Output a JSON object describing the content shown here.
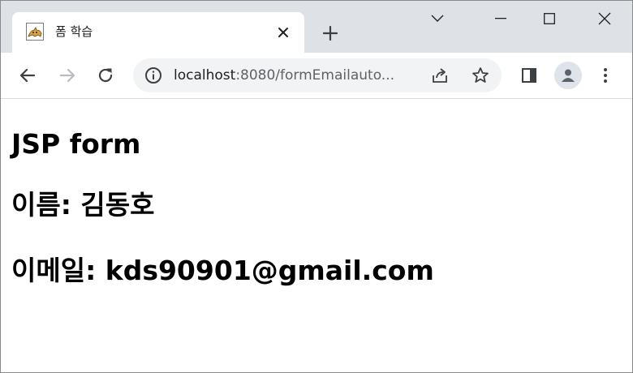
{
  "browser": {
    "tab": {
      "title": "폼 학습"
    },
    "address_bar": {
      "host": "localhost",
      "path": ":8080/formEmailauto..."
    }
  },
  "page": {
    "heading": "JSP form",
    "name_line": "이름: 김동호",
    "email_line": "이메일: kds90901@gmail.com"
  },
  "icons": {
    "favicon": "tomcat-favicon-icon",
    "tab_close": "close-icon",
    "new_tab": "plus-icon",
    "back": "arrow-left-icon",
    "forward": "arrow-right-icon",
    "reload": "reload-icon",
    "site_info": "info-icon",
    "share": "share-icon",
    "bookmark": "star-icon",
    "side_panel": "side-panel-icon",
    "profile": "profile-icon",
    "menu": "kebab-menu-icon"
  },
  "colors": {
    "tab_strip": "#dee1e6",
    "omnibox": "#f1f3f4",
    "icon": "#5f6368",
    "text": "#000000"
  }
}
